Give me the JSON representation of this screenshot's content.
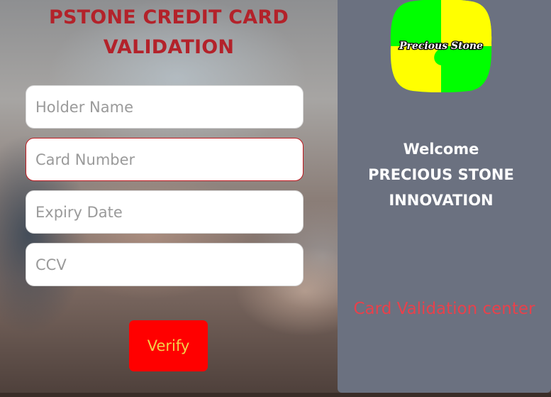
{
  "page": {
    "title_line1": "PSTONE CREDIT CARD",
    "title_line2": "VALIDATION"
  },
  "form": {
    "holder_name": {
      "placeholder": "Holder Name",
      "value": ""
    },
    "card_number": {
      "placeholder": "Card Number",
      "value": ""
    },
    "expiry_date": {
      "placeholder": "Expiry Date",
      "value": ""
    },
    "ccv": {
      "placeholder": "CCV",
      "value": ""
    },
    "verify_label": "Verify"
  },
  "sidebar": {
    "logo_text": "Precious Stone",
    "welcome_line1": "Welcome",
    "welcome_line2": "PRECIOUS STONE",
    "welcome_line3": "INNOVATION",
    "tagline": "Card Validation center"
  },
  "colors": {
    "title": "#b3222a",
    "verify_bg": "#ff0000",
    "verify_text": "#f2d14a",
    "sidebar_bg": "#6b7180",
    "tagline": "#e8414b",
    "logo_green": "#00ff00",
    "logo_yellow": "#ffff00"
  }
}
